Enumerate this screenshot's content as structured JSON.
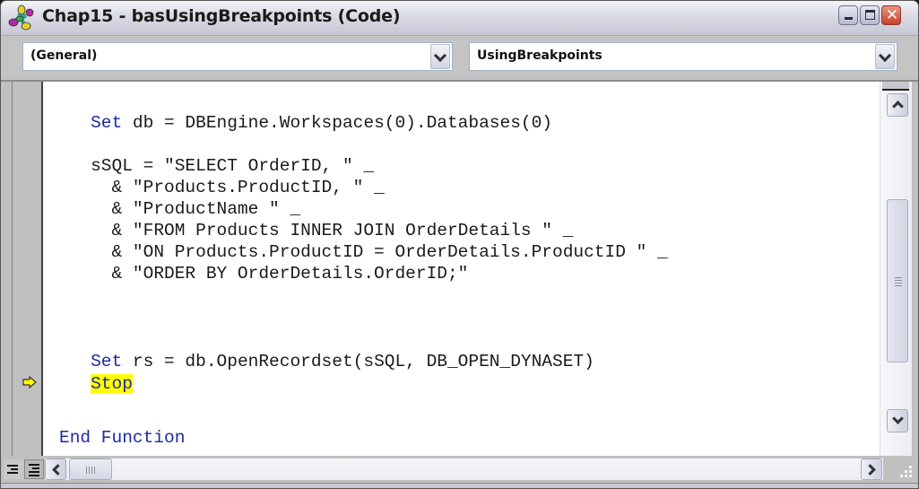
{
  "window": {
    "title": "Chap15 - basUsingBreakpoints (Code)",
    "icon": "vba-module-icon",
    "controls": {
      "minimize": "minimize-icon",
      "maximize": "maximize-icon",
      "close": "✕"
    }
  },
  "toolbar": {
    "object_combo": {
      "value": "(General)"
    },
    "procedure_combo": {
      "value": "UsingBreakpoints"
    }
  },
  "editor": {
    "current_line_marker": "execution-arrow-icon",
    "highlight_color": "#ffff00",
    "keyword_color": "#1c2ba0",
    "lines": [
      {
        "parts": [
          {
            "t": "   "
          },
          {
            "t": "Set",
            "kw": true
          },
          {
            "t": " db = DBEngine.Workspaces(0).Databases(0)"
          }
        ]
      },
      {
        "parts": [
          {
            "t": ""
          }
        ]
      },
      {
        "parts": [
          {
            "t": "   sSQL = \"SELECT OrderID, \" _"
          }
        ]
      },
      {
        "parts": [
          {
            "t": "     & \"Products.ProductID, \" _"
          }
        ]
      },
      {
        "parts": [
          {
            "t": "     & \"ProductName \" _"
          }
        ]
      },
      {
        "parts": [
          {
            "t": "     & \"FROM Products INNER JOIN OrderDetails \" _"
          }
        ]
      },
      {
        "parts": [
          {
            "t": "     & \"ON Products.ProductID = OrderDetails.ProductID \" _"
          }
        ]
      },
      {
        "parts": [
          {
            "t": "     & \"ORDER BY OrderDetails.OrderID;\""
          }
        ]
      },
      {
        "parts": [
          {
            "t": ""
          }
        ]
      },
      {
        "parts": [
          {
            "t": "   "
          },
          {
            "t": "Set",
            "kw": true
          },
          {
            "t": " rs = db.OpenRecordset(sSQL, DB_OPEN_DYNASET)"
          }
        ]
      },
      {
        "parts": [
          {
            "t": "   "
          },
          {
            "t": "Stop",
            "kw": true,
            "hl": true
          }
        ]
      },
      {
        "parts": [
          {
            "t": ""
          }
        ]
      },
      {
        "parts": [
          {
            "t": "End Function",
            "kw": true
          }
        ]
      }
    ]
  },
  "scrollbars": {
    "vertical": {
      "up": "scroll-up",
      "down": "scroll-down"
    },
    "horizontal": {
      "left": "scroll-left",
      "right": "scroll-right"
    }
  },
  "view_buttons": {
    "procedure_view": "procedure-view-icon",
    "full_module_view": "full-module-view-icon"
  }
}
